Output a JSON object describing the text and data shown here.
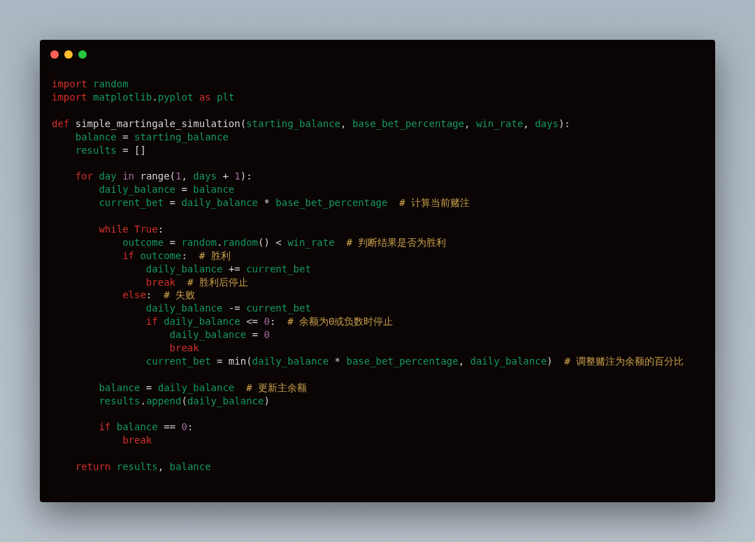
{
  "window": {
    "controls": [
      {
        "kind": "close"
      },
      {
        "kind": "minimize"
      },
      {
        "kind": "zoom"
      }
    ]
  },
  "code_blocks": [
    [
      [
        {
          "kind": "keyword",
          "text": "import "
        },
        {
          "kind": "name",
          "text": "random"
        }
      ],
      [
        {
          "kind": "keyword",
          "text": "import "
        },
        {
          "kind": "name",
          "text": "matplotlib"
        },
        {
          "kind": "plain",
          "text": "."
        },
        {
          "kind": "name",
          "text": "pyplot "
        },
        {
          "kind": "keyword",
          "text": "as "
        },
        {
          "kind": "name",
          "text": "plt"
        }
      ]
    ],
    [
      [
        {
          "kind": "keyword",
          "text": "def "
        },
        {
          "kind": "plain",
          "text": "simple_martingale_simulation("
        },
        {
          "kind": "name",
          "text": "starting_balance"
        },
        {
          "kind": "plain",
          "text": ", "
        },
        {
          "kind": "name",
          "text": "base_bet_percentage"
        },
        {
          "kind": "plain",
          "text": ", "
        },
        {
          "kind": "name",
          "text": "win_rate"
        },
        {
          "kind": "plain",
          "text": ", "
        },
        {
          "kind": "name",
          "text": "days"
        },
        {
          "kind": "plain",
          "text": "):"
        }
      ],
      [
        {
          "kind": "name",
          "text": "    balance "
        },
        {
          "kind": "plain",
          "text": "= "
        },
        {
          "kind": "name",
          "text": "starting_balance"
        }
      ],
      [
        {
          "kind": "name",
          "text": "    results "
        },
        {
          "kind": "plain",
          "text": "= []"
        }
      ]
    ],
    [
      [
        {
          "kind": "keyword",
          "text": "    for "
        },
        {
          "kind": "name",
          "text": "day "
        },
        {
          "kind": "number",
          "text": "in "
        },
        {
          "kind": "plain",
          "text": "range("
        },
        {
          "kind": "number",
          "text": "1"
        },
        {
          "kind": "plain",
          "text": ", "
        },
        {
          "kind": "name",
          "text": "days "
        },
        {
          "kind": "plain",
          "text": "+ "
        },
        {
          "kind": "number",
          "text": "1"
        },
        {
          "kind": "plain",
          "text": "):"
        }
      ],
      [
        {
          "kind": "name",
          "text": "        daily_balance "
        },
        {
          "kind": "plain",
          "text": "= "
        },
        {
          "kind": "name",
          "text": "balance"
        }
      ],
      [
        {
          "kind": "name",
          "text": "        current_bet "
        },
        {
          "kind": "plain",
          "text": "= "
        },
        {
          "kind": "name",
          "text": "daily_balance "
        },
        {
          "kind": "plain",
          "text": "* "
        },
        {
          "kind": "name",
          "text": "base_bet_percentage  "
        },
        {
          "kind": "comment",
          "text": "# 计算当前赌注"
        }
      ]
    ],
    [
      [
        {
          "kind": "keyword",
          "text": "        while True"
        },
        {
          "kind": "plain",
          "text": ":"
        }
      ],
      [
        {
          "kind": "name",
          "text": "            outcome "
        },
        {
          "kind": "plain",
          "text": "= "
        },
        {
          "kind": "name",
          "text": "random"
        },
        {
          "kind": "plain",
          "text": "."
        },
        {
          "kind": "name",
          "text": "random"
        },
        {
          "kind": "plain",
          "text": "() < "
        },
        {
          "kind": "name",
          "text": "win_rate  "
        },
        {
          "kind": "comment",
          "text": "# 判断结果是否为胜利"
        }
      ],
      [
        {
          "kind": "keyword",
          "text": "            if "
        },
        {
          "kind": "name",
          "text": "outcome"
        },
        {
          "kind": "plain",
          "text": ":  "
        },
        {
          "kind": "comment",
          "text": "# 胜利"
        }
      ],
      [
        {
          "kind": "name",
          "text": "                daily_balance "
        },
        {
          "kind": "plain",
          "text": "+= "
        },
        {
          "kind": "name",
          "text": "current_bet"
        }
      ],
      [
        {
          "kind": "keyword",
          "text": "                break  "
        },
        {
          "kind": "comment",
          "text": "# 胜利后停止"
        }
      ],
      [
        {
          "kind": "keyword",
          "text": "            else"
        },
        {
          "kind": "plain",
          "text": ":  "
        },
        {
          "kind": "comment",
          "text": "# 失败"
        }
      ],
      [
        {
          "kind": "name",
          "text": "                daily_balance "
        },
        {
          "kind": "plain",
          "text": "-= "
        },
        {
          "kind": "name",
          "text": "current_bet"
        }
      ],
      [
        {
          "kind": "keyword",
          "text": "                if "
        },
        {
          "kind": "name",
          "text": "daily_balance "
        },
        {
          "kind": "plain",
          "text": "<= "
        },
        {
          "kind": "number",
          "text": "0"
        },
        {
          "kind": "plain",
          "text": ":  "
        },
        {
          "kind": "comment",
          "text": "# 余额为0或负数时停止"
        }
      ],
      [
        {
          "kind": "name",
          "text": "                    daily_balance "
        },
        {
          "kind": "plain",
          "text": "= "
        },
        {
          "kind": "number",
          "text": "0"
        }
      ],
      [
        {
          "kind": "keyword",
          "text": "                    break"
        }
      ],
      [
        {
          "kind": "name",
          "text": "                current_bet "
        },
        {
          "kind": "plain",
          "text": "= min("
        },
        {
          "kind": "name",
          "text": "daily_balance "
        },
        {
          "kind": "plain",
          "text": "* "
        },
        {
          "kind": "name",
          "text": "base_bet_percentage"
        },
        {
          "kind": "plain",
          "text": ", "
        },
        {
          "kind": "name",
          "text": "daily_balance"
        },
        {
          "kind": "plain",
          "text": ")  "
        },
        {
          "kind": "comment",
          "text": "# 调整赌注为余额的百分比"
        }
      ]
    ],
    [
      [
        {
          "kind": "name",
          "text": "        balance "
        },
        {
          "kind": "plain",
          "text": "= "
        },
        {
          "kind": "name",
          "text": "daily_balance  "
        },
        {
          "kind": "comment",
          "text": "# 更新主余额"
        }
      ],
      [
        {
          "kind": "name",
          "text": "        results"
        },
        {
          "kind": "plain",
          "text": "."
        },
        {
          "kind": "name",
          "text": "append"
        },
        {
          "kind": "plain",
          "text": "("
        },
        {
          "kind": "name",
          "text": "daily_balance"
        },
        {
          "kind": "plain",
          "text": ")"
        }
      ]
    ],
    [
      [
        {
          "kind": "keyword",
          "text": "        if "
        },
        {
          "kind": "name",
          "text": "balance "
        },
        {
          "kind": "plain",
          "text": "== "
        },
        {
          "kind": "number",
          "text": "0"
        },
        {
          "kind": "plain",
          "text": ":"
        }
      ],
      [
        {
          "kind": "keyword",
          "text": "            break"
        }
      ]
    ],
    [
      [
        {
          "kind": "keyword",
          "text": "    return "
        },
        {
          "kind": "name",
          "text": "results"
        },
        {
          "kind": "plain",
          "text": ", "
        },
        {
          "kind": "name",
          "text": "balance"
        }
      ]
    ]
  ]
}
